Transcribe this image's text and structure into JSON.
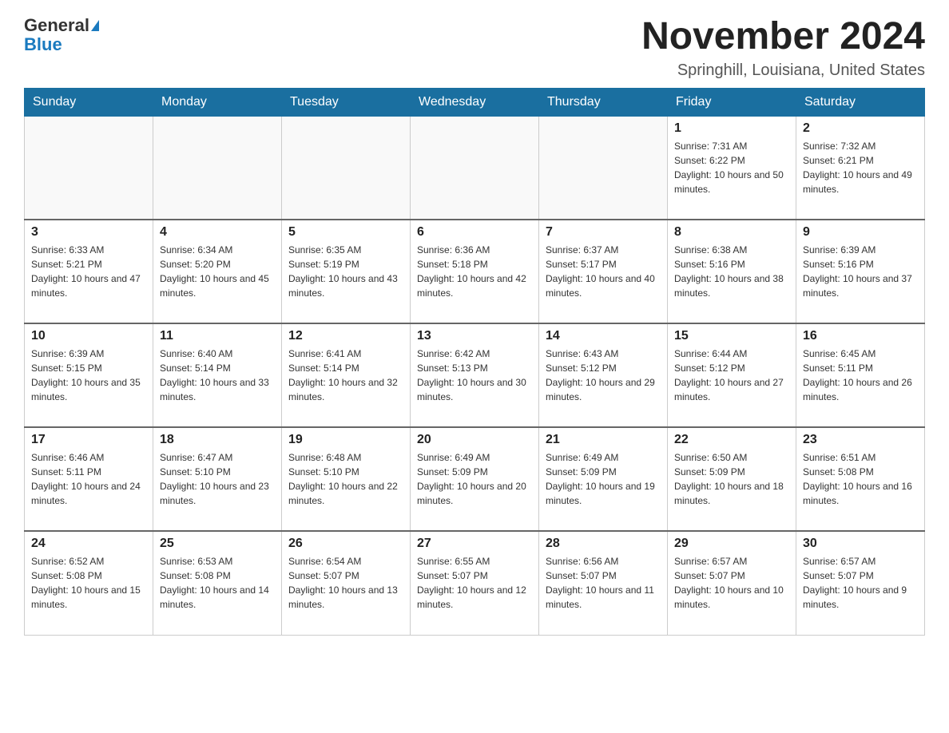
{
  "logo": {
    "general": "General",
    "blue": "Blue"
  },
  "header": {
    "month_year": "November 2024",
    "location": "Springhill, Louisiana, United States"
  },
  "weekdays": [
    "Sunday",
    "Monday",
    "Tuesday",
    "Wednesday",
    "Thursday",
    "Friday",
    "Saturday"
  ],
  "weeks": [
    [
      {
        "day": "",
        "sunrise": "",
        "sunset": "",
        "daylight": ""
      },
      {
        "day": "",
        "sunrise": "",
        "sunset": "",
        "daylight": ""
      },
      {
        "day": "",
        "sunrise": "",
        "sunset": "",
        "daylight": ""
      },
      {
        "day": "",
        "sunrise": "",
        "sunset": "",
        "daylight": ""
      },
      {
        "day": "",
        "sunrise": "",
        "sunset": "",
        "daylight": ""
      },
      {
        "day": "1",
        "sunrise": "Sunrise: 7:31 AM",
        "sunset": "Sunset: 6:22 PM",
        "daylight": "Daylight: 10 hours and 50 minutes."
      },
      {
        "day": "2",
        "sunrise": "Sunrise: 7:32 AM",
        "sunset": "Sunset: 6:21 PM",
        "daylight": "Daylight: 10 hours and 49 minutes."
      }
    ],
    [
      {
        "day": "3",
        "sunrise": "Sunrise: 6:33 AM",
        "sunset": "Sunset: 5:21 PM",
        "daylight": "Daylight: 10 hours and 47 minutes."
      },
      {
        "day": "4",
        "sunrise": "Sunrise: 6:34 AM",
        "sunset": "Sunset: 5:20 PM",
        "daylight": "Daylight: 10 hours and 45 minutes."
      },
      {
        "day": "5",
        "sunrise": "Sunrise: 6:35 AM",
        "sunset": "Sunset: 5:19 PM",
        "daylight": "Daylight: 10 hours and 43 minutes."
      },
      {
        "day": "6",
        "sunrise": "Sunrise: 6:36 AM",
        "sunset": "Sunset: 5:18 PM",
        "daylight": "Daylight: 10 hours and 42 minutes."
      },
      {
        "day": "7",
        "sunrise": "Sunrise: 6:37 AM",
        "sunset": "Sunset: 5:17 PM",
        "daylight": "Daylight: 10 hours and 40 minutes."
      },
      {
        "day": "8",
        "sunrise": "Sunrise: 6:38 AM",
        "sunset": "Sunset: 5:16 PM",
        "daylight": "Daylight: 10 hours and 38 minutes."
      },
      {
        "day": "9",
        "sunrise": "Sunrise: 6:39 AM",
        "sunset": "Sunset: 5:16 PM",
        "daylight": "Daylight: 10 hours and 37 minutes."
      }
    ],
    [
      {
        "day": "10",
        "sunrise": "Sunrise: 6:39 AM",
        "sunset": "Sunset: 5:15 PM",
        "daylight": "Daylight: 10 hours and 35 minutes."
      },
      {
        "day": "11",
        "sunrise": "Sunrise: 6:40 AM",
        "sunset": "Sunset: 5:14 PM",
        "daylight": "Daylight: 10 hours and 33 minutes."
      },
      {
        "day": "12",
        "sunrise": "Sunrise: 6:41 AM",
        "sunset": "Sunset: 5:14 PM",
        "daylight": "Daylight: 10 hours and 32 minutes."
      },
      {
        "day": "13",
        "sunrise": "Sunrise: 6:42 AM",
        "sunset": "Sunset: 5:13 PM",
        "daylight": "Daylight: 10 hours and 30 minutes."
      },
      {
        "day": "14",
        "sunrise": "Sunrise: 6:43 AM",
        "sunset": "Sunset: 5:12 PM",
        "daylight": "Daylight: 10 hours and 29 minutes."
      },
      {
        "day": "15",
        "sunrise": "Sunrise: 6:44 AM",
        "sunset": "Sunset: 5:12 PM",
        "daylight": "Daylight: 10 hours and 27 minutes."
      },
      {
        "day": "16",
        "sunrise": "Sunrise: 6:45 AM",
        "sunset": "Sunset: 5:11 PM",
        "daylight": "Daylight: 10 hours and 26 minutes."
      }
    ],
    [
      {
        "day": "17",
        "sunrise": "Sunrise: 6:46 AM",
        "sunset": "Sunset: 5:11 PM",
        "daylight": "Daylight: 10 hours and 24 minutes."
      },
      {
        "day": "18",
        "sunrise": "Sunrise: 6:47 AM",
        "sunset": "Sunset: 5:10 PM",
        "daylight": "Daylight: 10 hours and 23 minutes."
      },
      {
        "day": "19",
        "sunrise": "Sunrise: 6:48 AM",
        "sunset": "Sunset: 5:10 PM",
        "daylight": "Daylight: 10 hours and 22 minutes."
      },
      {
        "day": "20",
        "sunrise": "Sunrise: 6:49 AM",
        "sunset": "Sunset: 5:09 PM",
        "daylight": "Daylight: 10 hours and 20 minutes."
      },
      {
        "day": "21",
        "sunrise": "Sunrise: 6:49 AM",
        "sunset": "Sunset: 5:09 PM",
        "daylight": "Daylight: 10 hours and 19 minutes."
      },
      {
        "day": "22",
        "sunrise": "Sunrise: 6:50 AM",
        "sunset": "Sunset: 5:09 PM",
        "daylight": "Daylight: 10 hours and 18 minutes."
      },
      {
        "day": "23",
        "sunrise": "Sunrise: 6:51 AM",
        "sunset": "Sunset: 5:08 PM",
        "daylight": "Daylight: 10 hours and 16 minutes."
      }
    ],
    [
      {
        "day": "24",
        "sunrise": "Sunrise: 6:52 AM",
        "sunset": "Sunset: 5:08 PM",
        "daylight": "Daylight: 10 hours and 15 minutes."
      },
      {
        "day": "25",
        "sunrise": "Sunrise: 6:53 AM",
        "sunset": "Sunset: 5:08 PM",
        "daylight": "Daylight: 10 hours and 14 minutes."
      },
      {
        "day": "26",
        "sunrise": "Sunrise: 6:54 AM",
        "sunset": "Sunset: 5:07 PM",
        "daylight": "Daylight: 10 hours and 13 minutes."
      },
      {
        "day": "27",
        "sunrise": "Sunrise: 6:55 AM",
        "sunset": "Sunset: 5:07 PM",
        "daylight": "Daylight: 10 hours and 12 minutes."
      },
      {
        "day": "28",
        "sunrise": "Sunrise: 6:56 AM",
        "sunset": "Sunset: 5:07 PM",
        "daylight": "Daylight: 10 hours and 11 minutes."
      },
      {
        "day": "29",
        "sunrise": "Sunrise: 6:57 AM",
        "sunset": "Sunset: 5:07 PM",
        "daylight": "Daylight: 10 hours and 10 minutes."
      },
      {
        "day": "30",
        "sunrise": "Sunrise: 6:57 AM",
        "sunset": "Sunset: 5:07 PM",
        "daylight": "Daylight: 10 hours and 9 minutes."
      }
    ]
  ]
}
